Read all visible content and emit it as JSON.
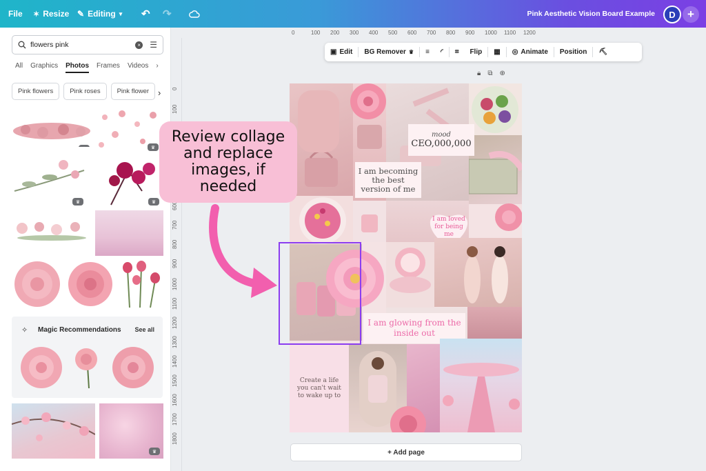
{
  "topbar": {
    "file": "File",
    "resize": "Resize",
    "editing": "Editing",
    "title": "Pink Aesthetic Vision Board Example",
    "avatar_initial": "D",
    "colors": {
      "gradient_start": "#1fb5c9",
      "gradient_end": "#7b3fe4"
    }
  },
  "sidebar": {
    "search_value": "flowers pink",
    "tabs": [
      "All",
      "Graphics",
      "Photos",
      "Frames",
      "Videos"
    ],
    "active_tab": "Photos",
    "chips": [
      "Pink flowers",
      "Pink roses",
      "Pink flower"
    ],
    "magic": {
      "title": "Magic Recommendations",
      "see_all": "See all"
    }
  },
  "ruler": {
    "top": [
      "0",
      "100",
      "200",
      "300",
      "400",
      "500",
      "600",
      "700",
      "800",
      "900",
      "1000",
      "1100",
      "1200"
    ],
    "left": [
      "0",
      "100",
      "600",
      "700",
      "800",
      "900",
      "1000",
      "1100",
      "1200",
      "1300",
      "1400",
      "1500",
      "1600",
      "1700",
      "1800"
    ]
  },
  "toolbar": {
    "edit": "Edit",
    "bg_remover": "BG Remover",
    "flip": "Flip",
    "animate": "Animate",
    "position": "Position"
  },
  "board": {
    "mood_label": "mood",
    "mood_value": "CEO,000,000",
    "quote_becoming": "I am becoming the best version of me",
    "quote_loved": "I am loved for being me",
    "quote_glowing": "I am glowing from the inside out",
    "quote_create": "Create a life you can't wait to wake up to"
  },
  "canvas": {
    "add_page": "+ Add page"
  },
  "callout": {
    "text": "Review collage and replace images, if needed",
    "color": "#f8bfd6",
    "arrow_color": "#f25fae"
  }
}
